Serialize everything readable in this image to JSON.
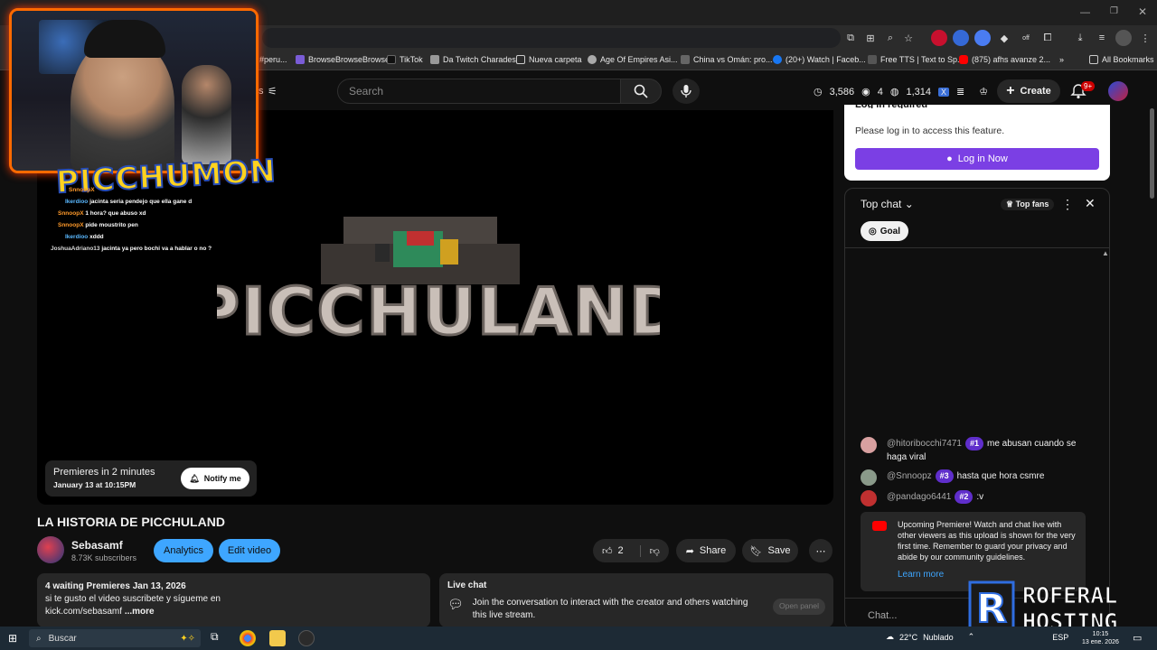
{
  "bookmarks": [
    {
      "label": "#peru...",
      "color": "#888"
    },
    {
      "label": "BrowseBrowseBrowse",
      "color": "#7a5cd6"
    },
    {
      "label": "TikTok",
      "color": "#111"
    },
    {
      "label": "Da Twitch Charades",
      "color": "#999"
    },
    {
      "label": "Nueva carpeta",
      "color": "#ccc"
    },
    {
      "label": "Age Of Empires Asi...",
      "color": "#aaa"
    },
    {
      "label": "China vs Omán: pro...",
      "color": "#666"
    },
    {
      "label": "(20+) Watch | Faceb...",
      "color": "#1877f2"
    },
    {
      "label": "Free TTS | Text to Sp...",
      "color": "#555"
    },
    {
      "label": "(875) afhs avanze 2...",
      "color": "#ff0000"
    },
    {
      "label": "All Bookmarks",
      "color": "#ccc"
    }
  ],
  "header": {
    "search_placeholder": "Search",
    "create_label": "Create",
    "notif_badge": "9+",
    "stat_time": "3,586",
    "stat_views": "4",
    "stat_users": "1,314",
    "partial_label": "s"
  },
  "player": {
    "title_art": "PICCHULAND",
    "premiere_text": "Premieres in 2 minutes",
    "premiere_date": "January 13 at 10:15PM",
    "notify_label": "Notify me"
  },
  "overlay": {
    "cam_logo": "PICCHUMON",
    "chat": [
      {
        "user": "SnnoopX",
        "text": "",
        "color": "#ff9a2a"
      },
      {
        "user": "Ikerdioo",
        "text": "jacinta seria pendejo que ella gane d",
        "color": "#5ab8ff"
      },
      {
        "user": "SnnoopX",
        "text": "1 hora? que abuso xd",
        "color": "#ff9a2a"
      },
      {
        "user": "SnnoopX",
        "text": "pide moustrito pen",
        "color": "#ff9a2a"
      },
      {
        "user": "Ikerdioo",
        "text": "xddd",
        "color": "#5ab8ff"
      },
      {
        "user": "JoshuaAdriano13",
        "text": "jacinta ya pero bochi va a hablar o no ?",
        "color": "#d9d9d9"
      }
    ]
  },
  "video": {
    "title": "LA HISTORIA DE PICCHULAND",
    "channel": "Sebasamf",
    "subs": "8.73K subscribers",
    "analytics_label": "Analytics",
    "edit_label": "Edit video",
    "like_count": "2",
    "share_label": "Share",
    "save_label": "Save",
    "desc_meta": "4 waiting  Premieres Jan 13, 2026",
    "desc_line1": "si te gusto el video suscribete y sígueme en",
    "desc_line2": "kick.com/sebasamf",
    "desc_more": "...more",
    "livechat_title": "Live chat",
    "livechat_text": "Join the conversation to interact with the creator and others watching this live stream.",
    "open_panel": "Open panel"
  },
  "sidepanel": {
    "login_title": "Log in required",
    "login_text": "Please log in to access this feature.",
    "login_btn": "Log in Now",
    "chat_mode": "Top chat",
    "top_fans": "Top fans",
    "goal": "Goal",
    "messages": [
      {
        "author": "@hitoribocchi7471",
        "rank": "#1",
        "text": "me abusan cuando se haga viral",
        "color": "#d8a0a0"
      },
      {
        "author": "@Snnoopz",
        "rank": "#3",
        "text": "hasta que hora csmre",
        "color": "#8a9a8a"
      },
      {
        "author": "@pandago6441",
        "rank": "#2",
        "text": ":v",
        "color": "#c03030"
      }
    ],
    "upcoming_text": "Upcoming Premiere! Watch and chat live with other viewers as this upload is shown for the very first time. Remember to guard your privacy and abide by our community guidelines.",
    "learn_more": "Learn more",
    "chat_placeholder": "Chat..."
  },
  "watermark": {
    "line1": "ROFERAL",
    "line2": "HOSTING"
  },
  "taskbar": {
    "search": "Buscar",
    "temp": "22°C",
    "weather": "Nublado",
    "lang": "ESP",
    "time": "10:15",
    "date": "13 ene. 2026"
  },
  "colors": {
    "accent": "#3ea6ff",
    "purple": "#7b3fe4",
    "brand_red": "#ff0000",
    "cam_border": "#ff6a00"
  }
}
